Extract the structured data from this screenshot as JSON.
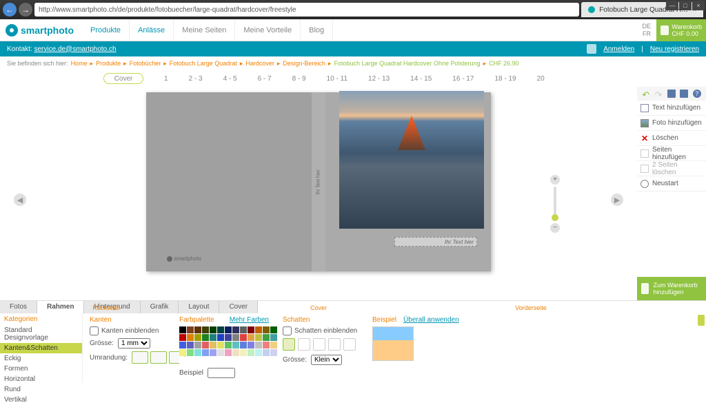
{
  "browser": {
    "url": "http://www.smartphoto.ch/de/produkte/fotobuecher/large-quadrat/hardcover/freestyle",
    "tab_title": "Fotobuch Large Quadrat H…"
  },
  "header": {
    "brand": "smartphoto",
    "nav": [
      "Produkte",
      "Anlässe",
      "Meine Seiten",
      "Meine Vorteile",
      "Blog"
    ],
    "lang": [
      "DE",
      "FR"
    ],
    "cart_label": "Warenkorb",
    "cart_value": "CHF 0.00"
  },
  "contact": {
    "label": "Kontakt:",
    "email": "service.de@smartphoto.ch",
    "login": "Anmelden",
    "register": "Neu registrieren"
  },
  "breadcrumb": {
    "prefix": "Sie befinden sich hier:",
    "items": [
      "Home",
      "Produkte",
      "Fotobücher",
      "Fotobuch Large Quadrat",
      "Hardcover",
      "Design-Bereich"
    ],
    "current": "Fotobuch Large Quadrat Hardcover Ohne Polsterung",
    "price": "CHF 26.90"
  },
  "pages": {
    "cover": "Cover",
    "spreads": [
      "1",
      "2 - 3",
      "4 - 5",
      "6 - 7",
      "8 - 9",
      "10 - 11",
      "12 - 13",
      "14 - 15",
      "16 - 17",
      "18 - 19",
      "20"
    ]
  },
  "canvas": {
    "spine_text": "Ihr Text hier",
    "text_placeholder": "Ihr Text hier",
    "brand": "smartphoto",
    "labels": [
      "Rückseite",
      "Cover",
      "Vorderseite"
    ]
  },
  "side": {
    "items": [
      {
        "label": "Text hinzufügen",
        "icon": "txt"
      },
      {
        "label": "Foto hinzufügen",
        "icon": "img"
      },
      {
        "label": "Löschen",
        "icon": "del"
      },
      {
        "label": "Seiten hinzufügen",
        "icon": "page"
      },
      {
        "label": "2 Seiten löschen",
        "icon": "page",
        "disabled": true
      },
      {
        "label": "Neustart",
        "icon": "restart"
      }
    ],
    "to_cart": "Zum Warenkorb hinzufügen"
  },
  "bottom": {
    "tabs": [
      "Fotos",
      "Rahmen",
      "Hintergrund",
      "Grafik",
      "Layout",
      "Cover"
    ],
    "active_tab": "Rahmen",
    "categories": {
      "header": "Kategorien",
      "items": [
        "Standard Designvorlage",
        "Kanten&Schatten",
        "Eckig",
        "Formen",
        "Horizontal",
        "Rund",
        "Vertikal"
      ],
      "active": "Kanten&Schatten"
    },
    "edges": {
      "header": "Kanten",
      "show": "Kanten einblenden",
      "size_label": "Grösse:",
      "size_value": "1 mm",
      "border_label": "Umrandung:",
      "example_label": "Beispiel"
    },
    "palette": {
      "header": "Farbpalette",
      "more": "Mehr Farben",
      "colors": [
        "#000",
        "#804020",
        "#603000",
        "#404000",
        "#004000",
        "#004040",
        "#002060",
        "#303060",
        "#606060",
        "#800000",
        "#c06000",
        "#806000",
        "#006000",
        "#c00000",
        "#e08000",
        "#a0a000",
        "#208020",
        "#208080",
        "#2040c0",
        "#4040a0",
        "#808080",
        "#e04040",
        "#e0a040",
        "#c0c040",
        "#40a040",
        "#40a0a0",
        "#4060e0",
        "#6060c0",
        "#a0a0a0",
        "#e06060",
        "#e0c060",
        "#e0e060",
        "#60c060",
        "#60c0c0",
        "#6080e0",
        "#8080e0",
        "#c0c0c0",
        "#f08080",
        "#f0d080",
        "#f0f080",
        "#80e080",
        "#80e0e0",
        "#80a0f0",
        "#a0a0f0",
        "#e0e0e0",
        "#f0a0c0",
        "#f0e0c0",
        "#f0f0c0",
        "#c0f0c0",
        "#c0f0f0",
        "#c0d0f0",
        "#d0d0f0",
        "#ffffff"
      ]
    },
    "shadow": {
      "header": "Schatten",
      "show": "Schatten einblenden",
      "size_label": "Grösse:",
      "size_value": "Klein"
    },
    "preview": {
      "header": "Beispiel",
      "apply_all": "Überall anwenden"
    }
  }
}
